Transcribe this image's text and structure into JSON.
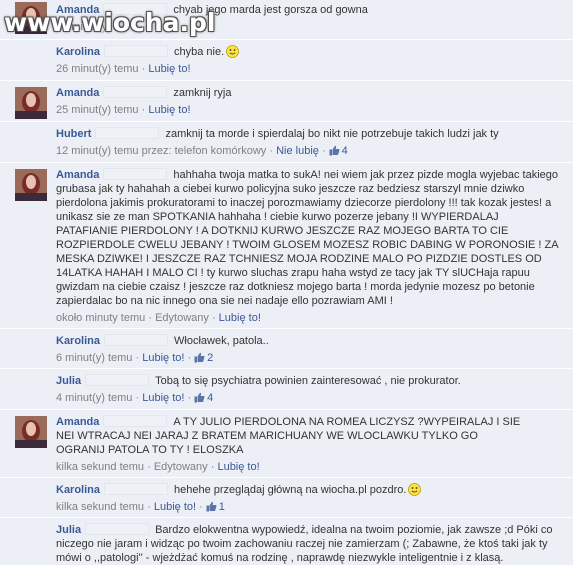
{
  "watermark": {
    "text": "www.wiocha.pl"
  },
  "comments": [
    {
      "author": "Amanda",
      "text": "chyab jego marda jest gorsza od gowna",
      "time": "26 minut(y)",
      "actions": "",
      "likes": ""
    },
    {
      "author": "Karolina",
      "text": "chyba nie.",
      "emoticon": "smiley",
      "time": "26 minut(y) temu",
      "like_label": "Lubię to!"
    },
    {
      "author": "Amanda",
      "text": "zamknij ryja",
      "time": "25 minut(y) temu",
      "like_label": "Lubię to!"
    },
    {
      "author": "Hubert",
      "text": "zamknij ta morde i spierdalaj bo nikt nie potrzebuje takich ludzi jak ty",
      "time": "12 minut(y) temu przez: telefon komórkowy",
      "like_label": "Nie lubię",
      "likes": "4"
    },
    {
      "author": "Amanda",
      "text": "hahhaha twoja matka to sukA! nei wiem jak przez pizde mogla wyjebac takiego grubasa jak ty hahahah a ciebei kurwo policyjna suko jeszcze raz bedziesz starszyl mnie dziwko pierdolona jakimis prokuratorami to inaczej porozmawiamy dziecorze pierdolony !!! tak kozak jestes! a unikasz sie ze man SPOTKANIA hahhaha ! ciebie kurwo pozerze jebany !I WYPIERDALAJ PATAFIANIE PIERDOLONY ! A DOTKNIJ KURWO JESZCZE RAZ MOJEGO BARTA TO CIE ROZPIERDOLE CWELU JEBANY ! TWOIM GLOSEM MOZESZ ROBIC DABING W PORONOSIE ! ZA MESKA DZIWKE! I JESZCZE RAZ TCHNIESZ MOJA RODZINE MALO PO PIZDZIE DOSTLES OD 14LATKA HAHAH I MALO CI ! ty kurwo sluchas zrapu haha wstyd ze tacy jak TY slUCHaja rapuu gwizdam na ciebie czaisz ! jeszcze raz dotkniesz mojego barta ! morda jedynie mozesz po betonie zapierdalac bo na nic innego ona sie nei nadaje ello pozrawiam AMI !",
      "time": "około minuty temu",
      "edited": "Edytowany",
      "like_label": "Lubię to!"
    },
    {
      "author": "Karolina",
      "text": "Włocławek, patola..",
      "time": "6 minut(y) temu",
      "like_label": "Lubię to!",
      "likes": "2"
    },
    {
      "author": "Julia",
      "text": "Tobą to się psychiatra powinien zainteresować , nie prokurator.",
      "time": "4 minut(y) temu",
      "like_label": "Lubię to!",
      "likes": "4"
    },
    {
      "author": "Amanda",
      "text": "A TY JULIO PIERDOLONA NA ROMEA LICZYSZ ?WYPEIRALAJ I SIE NEI WTRACAJ NEI JARAJ Z BRATEM MARICHUANY WE WLOCLAWKU TYLKO GO OGRANIJ PATOLA TO TY ! ELOSZKA",
      "time": "kilka sekund temu",
      "edited": "Edytowany",
      "like_label": "Lubię to!"
    },
    {
      "author": "Karolina",
      "text": "hehehe przeglądaj główną na wiocha.pl pozdro.",
      "emoticon": "smiley",
      "time": "kilka sekund temu",
      "like_label": "Lubię to!",
      "likes": "1"
    },
    {
      "author": "Julia",
      "text": "Bardzo elokwentna wypowiedź, idealna na twoim poziomie, jak zawsze ;d Póki co niczego nie jaram i widząc po twoim zachowaniu raczej nie zamierzam (; Zabawne, że ktoś taki jak ty mówi o ,,patologi'' - wjeżdżać komuś na rodzinę , naprawdę niezwykle inteligentnie i z klasą."
    }
  ]
}
